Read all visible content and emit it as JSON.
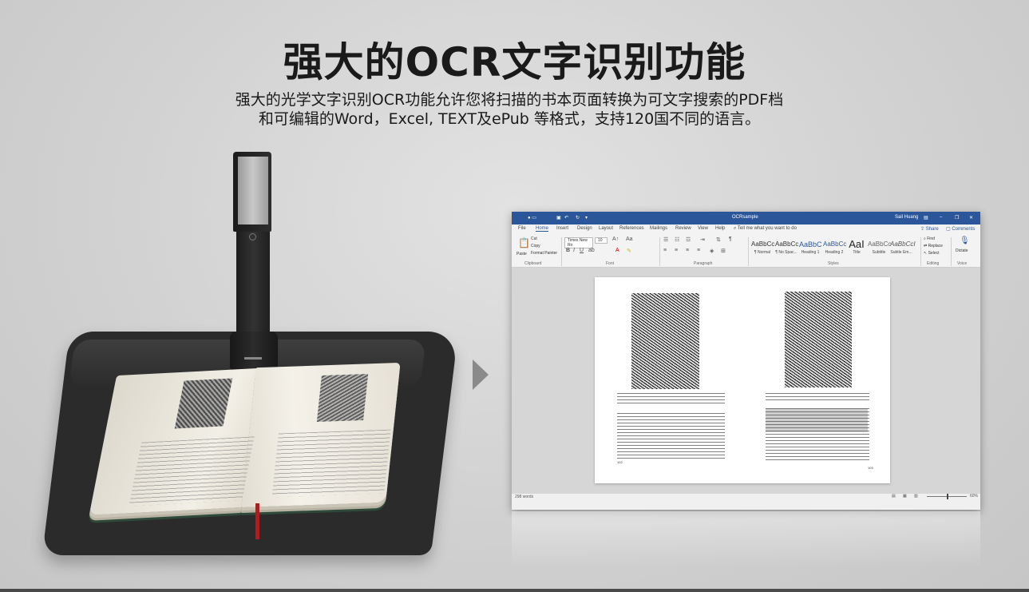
{
  "headline": "强大的OCR文字识别功能",
  "subtitle_line1": "强大的光学文字识别OCR功能允许您将扫描的书本页面转换为可文字搜索的PDF档",
  "subtitle_line2": "和可编辑的Word，Excel, TEXT及ePub 等格式，支持120国不同的语言。",
  "colors": {
    "word_blue": "#2b579a",
    "background": "#d2d2d2"
  },
  "word_window": {
    "title": "OCRsample",
    "user": "Sail Huang",
    "titlebar_icons": [
      "save-icon",
      "undo-icon",
      "redo-icon",
      "ribbon-display-icon",
      "minimize-icon",
      "restore-icon",
      "close-icon"
    ],
    "menu": [
      "File",
      "Home",
      "Insert",
      "Design",
      "Layout",
      "References",
      "Mailings",
      "Review",
      "View",
      "Help"
    ],
    "active_menu": "Home",
    "tell_me": "Tell me what you want to do",
    "share": "Share",
    "comments": "Comments",
    "clipboard": {
      "paste": "Paste",
      "cut": "Cut",
      "copy": "Copy",
      "format_painter": "Format Painter",
      "label": "Clipboard"
    },
    "font": {
      "name": "Times New Ro",
      "size": "10",
      "label": "Font"
    },
    "paragraph_label": "Paragraph",
    "styles": [
      {
        "sample": "AaBbCc",
        "name": "¶ Normal"
      },
      {
        "sample": "AaBbCc",
        "name": "¶ No Spac..."
      },
      {
        "sample": "AaBbC",
        "name": "Heading 1"
      },
      {
        "sample": "AaBbCc",
        "name": "Heading 2"
      },
      {
        "sample": "AaI",
        "name": "Title"
      },
      {
        "sample": "AaBbCc",
        "name": "Subtitle"
      },
      {
        "sample": "AaBbCcI",
        "name": "Subtle Em..."
      }
    ],
    "styles_label": "Styles",
    "editing": {
      "find": "Find",
      "replace": "Replace",
      "select": "Select",
      "label": "Editing"
    },
    "voice": {
      "dictate": "Dictate",
      "label": "Voice"
    },
    "doc_page_numbers": {
      "left": "102",
      "right": "103"
    },
    "status": {
      "words": "298 words",
      "zoom": "60%"
    }
  }
}
